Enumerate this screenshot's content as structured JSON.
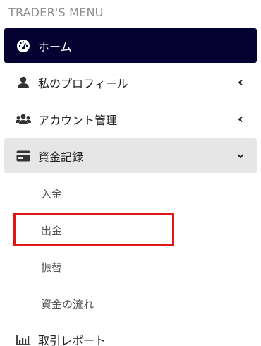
{
  "menu": {
    "section_title": "TRADER'S MENU",
    "items": [
      {
        "label": "ホーム",
        "icon": "dashboard-gauge-icon"
      },
      {
        "label": "私のプロフィール",
        "icon": "user-icon"
      },
      {
        "label": "アカウント管理",
        "icon": "users-group-icon"
      },
      {
        "label": "資金記録",
        "icon": "credit-card-icon"
      },
      {
        "label": "取引レポート",
        "icon": "bar-chart-icon"
      }
    ],
    "submenu": [
      {
        "label": "入金"
      },
      {
        "label": "出金"
      },
      {
        "label": "振替"
      },
      {
        "label": "資金の流れ"
      }
    ]
  },
  "colors": {
    "active_bg": "#050231",
    "open_bg": "#e6e6e6",
    "highlight_border": "#e01515"
  }
}
